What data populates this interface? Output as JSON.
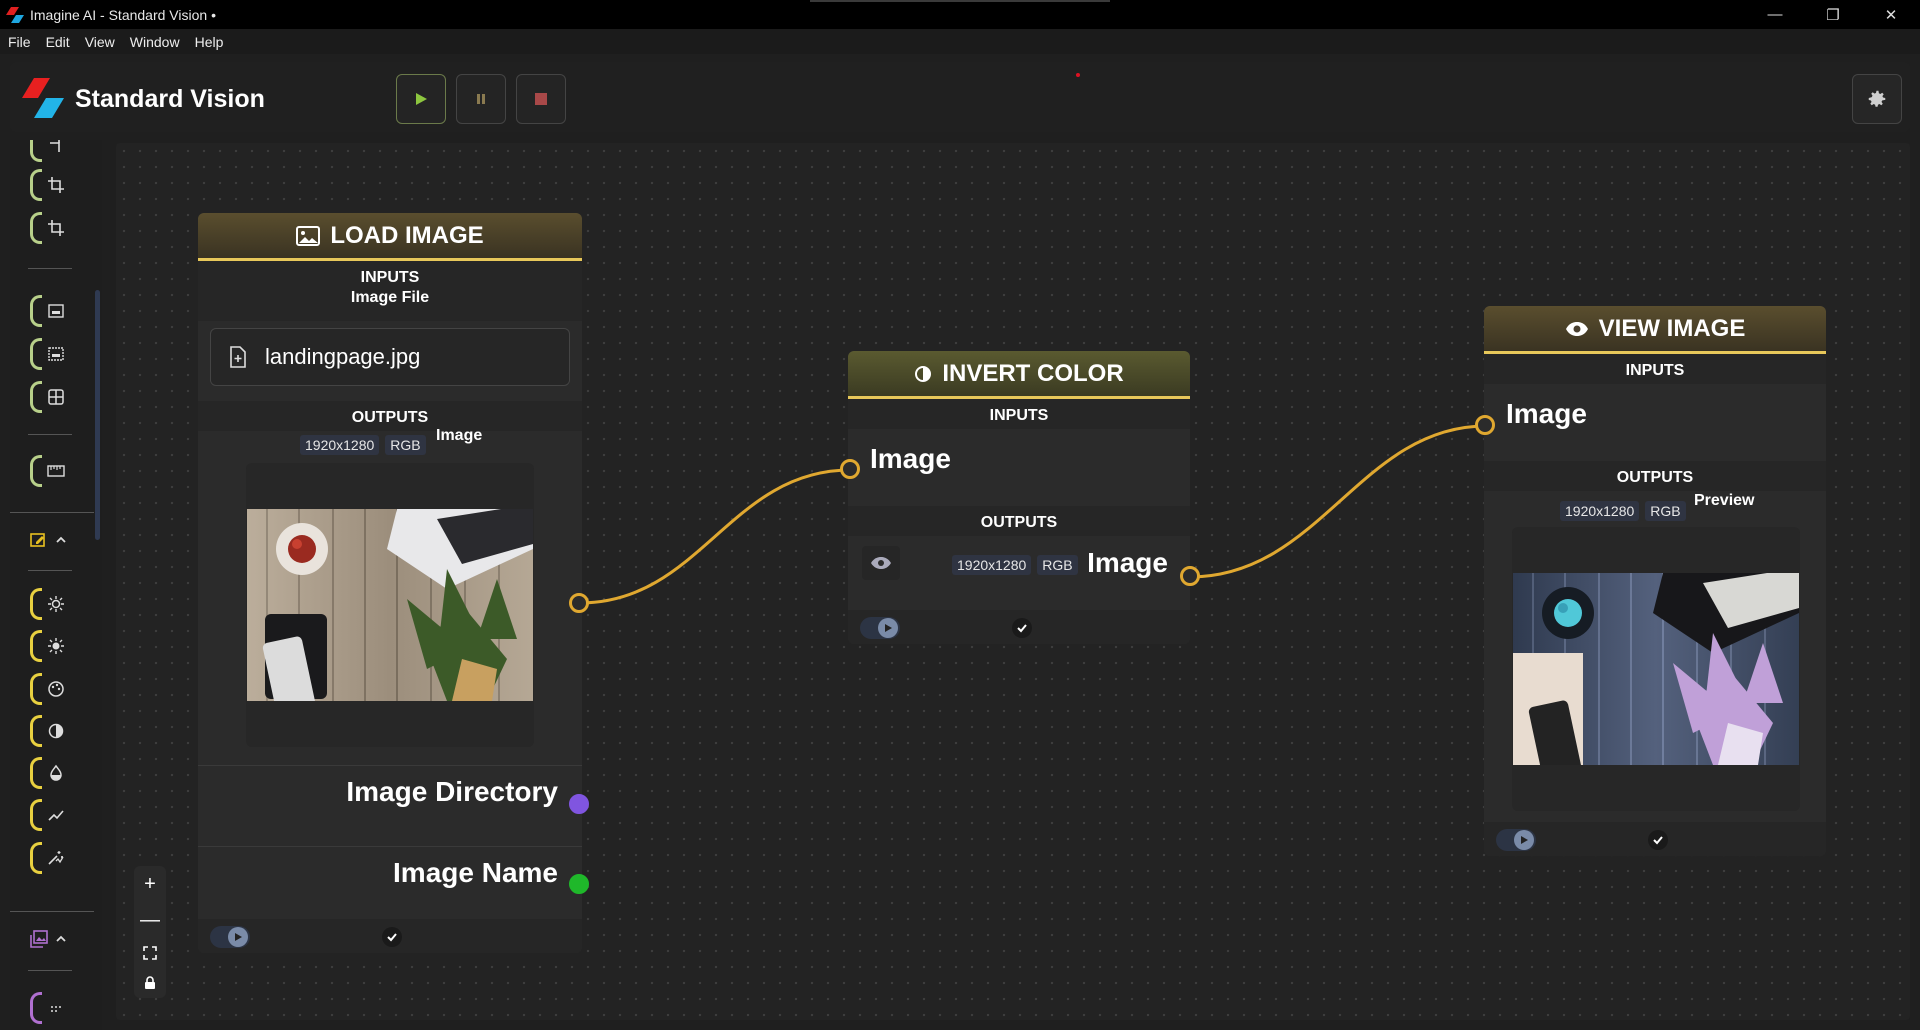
{
  "window": {
    "title": "Imagine AI - Standard Vision •",
    "minimize": "—",
    "restore": "❐",
    "close": "✕"
  },
  "menu": [
    "File",
    "Edit",
    "View",
    "Window",
    "Help"
  ],
  "header": {
    "app_name": "Standard Vision"
  },
  "colors": {
    "accent_gold": "#e0a830",
    "purple_port": "#8055e0",
    "green_port": "#1fb82a",
    "play_green": "#8dc63f"
  },
  "nodes": {
    "load_image": {
      "title": "LOAD IMAGE",
      "inputs_label": "INPUTS",
      "input_name": "Image File",
      "file_value": "landingpage.jpg",
      "outputs_label": "OUTPUTS",
      "resolution": "1920x1280",
      "mode": "RGB",
      "output_image_label": "Image",
      "output_dir_label": "Image Directory",
      "output_name_label": "Image Name"
    },
    "invert_color": {
      "title": "INVERT COLOR",
      "inputs_label": "INPUTS",
      "input_name": "Image",
      "outputs_label": "OUTPUTS",
      "resolution": "1920x1280",
      "mode": "RGB",
      "output_name": "Image"
    },
    "view_image": {
      "title": "VIEW IMAGE",
      "inputs_label": "INPUTS",
      "input_name": "Image",
      "outputs_label": "OUTPUTS",
      "resolution": "1920x1280",
      "mode": "RGB",
      "output_name": "Preview"
    }
  },
  "zoom_controls": {
    "zoom_in": "+",
    "zoom_out": "—"
  }
}
